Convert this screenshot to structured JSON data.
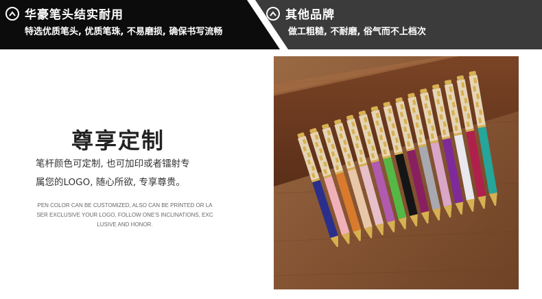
{
  "left_panel": {
    "icon": "chevron-up-icon",
    "title": "华豪笔头结实耐用",
    "subtitle": "特选优质笔头, 优质笔珠, 不易磨损, 确保书写流畅"
  },
  "right_panel": {
    "icon": "chevron-up-icon",
    "title": "其他品牌",
    "subtitle": "做工粗糙, 不耐磨, 俗气而不上档次"
  },
  "section": {
    "title": "尊享定制",
    "cn_lines": [
      "笔杆颜色可定制, 也可加印或者镭射专",
      "属您的LOGO, 随心所欲, 专享尊贵。"
    ],
    "en_text": "PEN COLOR CAN BE CUSTOMIZED, ALSO CAN BE PRINTED OR LASER EXCLUSIVE YOUR LOGO, FOLLOW ONE'S INCLINATIONS, EXCLUSIVE AND HONOR."
  },
  "colors": {
    "bar_dark": "#0c0c0c",
    "bar_light": "#3a3a3a",
    "wood": "#8a5a36",
    "gold": "#d7b052"
  },
  "pens": {
    "barrel_colors": [
      "#2a2f8c",
      "#f0b0b8",
      "#d97a2c",
      "#e8c7a8",
      "#e6bfc8",
      "#b05ab0",
      "#55b845",
      "#151515",
      "#8a1f60",
      "#a8a8b0",
      "#d9a6c8",
      "#7f2a9a",
      "#e8e8ee",
      "#b0204c",
      "#26a59a"
    ]
  }
}
